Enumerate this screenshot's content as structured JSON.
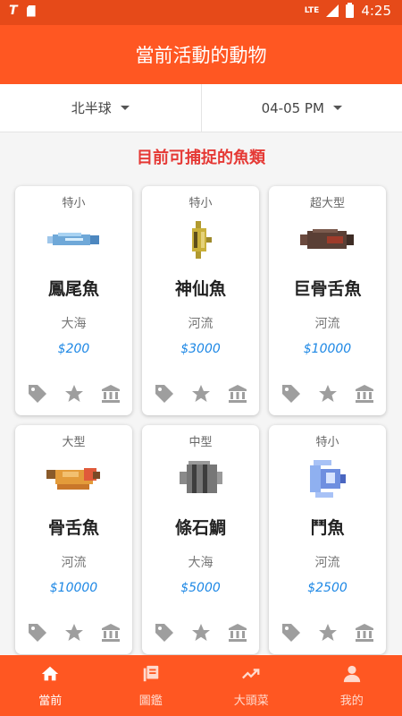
{
  "status_bar": {
    "app_logo": "T",
    "network": "LTE",
    "time": "4:25"
  },
  "header": {
    "title": "當前活動的動物"
  },
  "filters": {
    "hemisphere": "北半球",
    "time_range": "04-05 PM"
  },
  "section_title": "目前可捕捉的魚類",
  "fish": [
    {
      "size": "特小",
      "name": "鳳尾魚",
      "location": "大海",
      "price": "$200",
      "icon": "anchovy-icon",
      "color": "#6fa8d8"
    },
    {
      "size": "特小",
      "name": "神仙魚",
      "location": "河流",
      "price": "$3000",
      "icon": "angelfish-icon",
      "color": "#c9b03a"
    },
    {
      "size": "超大型",
      "name": "巨骨舌魚",
      "location": "河流",
      "price": "$10000",
      "icon": "arapaima-icon",
      "color": "#5a3f35"
    },
    {
      "size": "大型",
      "name": "骨舌魚",
      "location": "河流",
      "price": "$10000",
      "icon": "arowana-icon",
      "color": "#e39b3a"
    },
    {
      "size": "中型",
      "name": "條石鯛",
      "location": "大海",
      "price": "$5000",
      "icon": "barred-knifejaw-icon",
      "color": "#777777"
    },
    {
      "size": "特小",
      "name": "鬥魚",
      "location": "河流",
      "price": "$2500",
      "icon": "betta-icon",
      "color": "#6f8fe0"
    }
  ],
  "card_actions": [
    "tag-icon",
    "star-icon",
    "museum-icon"
  ],
  "bottom_nav": [
    {
      "label": "當前",
      "icon": "home-icon",
      "active": true
    },
    {
      "label": "圖鑑",
      "icon": "book-icon",
      "active": false
    },
    {
      "label": "大頭菜",
      "icon": "trend-icon",
      "active": false
    },
    {
      "label": "我的",
      "icon": "person-icon",
      "active": false
    }
  ],
  "colors": {
    "primary": "#ff5722",
    "status_bar": "#e64a19",
    "accent_red": "#e53935",
    "price_blue": "#1e88e5"
  }
}
